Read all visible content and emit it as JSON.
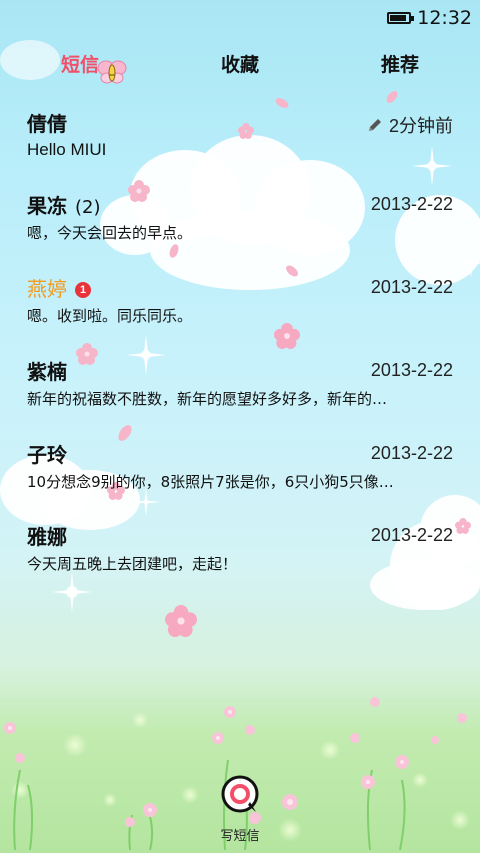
{
  "status": {
    "time": "12:32",
    "battery_level": 0.85
  },
  "tabs": [
    {
      "label": "短信",
      "active": true
    },
    {
      "label": "收藏",
      "active": false
    },
    {
      "label": "推荐",
      "active": false
    }
  ],
  "threads": [
    {
      "name": "倩倩",
      "count": "",
      "time": "2分钟前",
      "preview": "Hello MIUI",
      "has_draft_icon": true,
      "unread": false,
      "badge": ""
    },
    {
      "name": "果冻",
      "count": "(2)",
      "time": "2013-2-22",
      "preview": "嗯，今天会回去的早点。",
      "has_draft_icon": false,
      "unread": false,
      "badge": ""
    },
    {
      "name": "燕婷",
      "count": "",
      "time": "2013-2-22",
      "preview": "嗯。收到啦。同乐同乐。",
      "has_draft_icon": false,
      "unread": true,
      "badge": "1"
    },
    {
      "name": "紫楠",
      "count": "",
      "time": "2013-2-22",
      "preview": "新年的祝福数不胜数，新年的愿望好多好多，新年的…",
      "has_draft_icon": false,
      "unread": false,
      "badge": ""
    },
    {
      "name": "子玲",
      "count": "",
      "time": "2013-2-22",
      "preview": "10分想念9别的你，8张照片7张是你，6只小狗5只像…",
      "has_draft_icon": false,
      "unread": false,
      "badge": ""
    },
    {
      "name": "雅娜",
      "count": "",
      "time": "2013-2-22",
      "preview": "今天周五晚上去团建吧，走起！",
      "has_draft_icon": false,
      "unread": false,
      "badge": ""
    }
  ],
  "compose": {
    "label": "写短信",
    "icon": "message-bubble-icon"
  },
  "colors": {
    "accent": "#f2506a",
    "unread_name": "#f49a1e",
    "badge": "#e8333b"
  }
}
